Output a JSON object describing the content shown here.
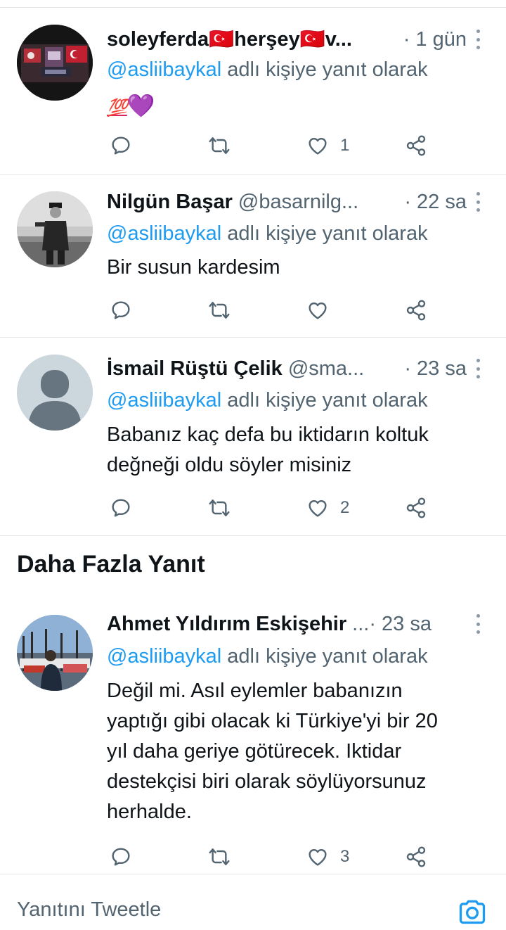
{
  "replies": [
    {
      "name": "soleyferda🇹🇷herşey🇹🇷v...",
      "handle": "",
      "time": "· 1 gün",
      "reply_to_mention": "@asliibaykal",
      "reply_to_suffix": " adlı kişiye yanıt olarak",
      "text_emoji_100": "💯",
      "text_emoji_heart": "💜",
      "likes": "1",
      "avatar": "flag-avatar"
    },
    {
      "name": "Nilgün Başar",
      "handle": "@basarnilg...",
      "time": "· 22 sa",
      "reply_to_mention": "@asliibaykal",
      "reply_to_suffix": " adlı kişiye yanıt olarak",
      "text": "Bir susun kardesim",
      "likes": "",
      "avatar": "bw-portrait-avatar"
    },
    {
      "name": "İsmail Rüştü Çelik",
      "handle": "@sma...",
      "time": "· 23 sa",
      "reply_to_mention": "@asliibaykal",
      "reply_to_suffix": " adlı kişiye yanıt olarak",
      "text_lines": [
        "Babanız kaç defa bu iktidarın koltuk",
        "değneği oldu söyler misiniz"
      ],
      "likes": "2",
      "avatar": "default-avatar"
    }
  ],
  "more_replies_title": "Daha Fazla Yanıt",
  "extra_reply": {
    "name": "Ahmet Yıldırım Eskişehir",
    "handle": "...",
    "time": "· 23 sa",
    "reply_to_mention": "@asliibaykal",
    "reply_to_suffix": " adlı kişiye yanıt olarak",
    "text_lines": [
      "Değil mi. Asıl eylemler babanızın",
      "yaptığı gibi olacak ki Türkiye'yi bir 20",
      "yıl daha geriye götürecek. Iktidar",
      "destekçisi biri olarak söylüyorsunuz",
      "herhalde."
    ],
    "likes": "3",
    "avatar": "harbor-photo-avatar"
  },
  "compose_placeholder": "Yanıtını Tweetle",
  "icons": {
    "reply": "reply-icon",
    "retweet": "retweet-icon",
    "like": "heart-icon",
    "share": "share-icon",
    "camera": "camera-icon",
    "more": "more-vertical-icon"
  },
  "colors": {
    "mention": "#1d9bf0",
    "secondary": "#536471",
    "primary_text": "#0f1419"
  }
}
